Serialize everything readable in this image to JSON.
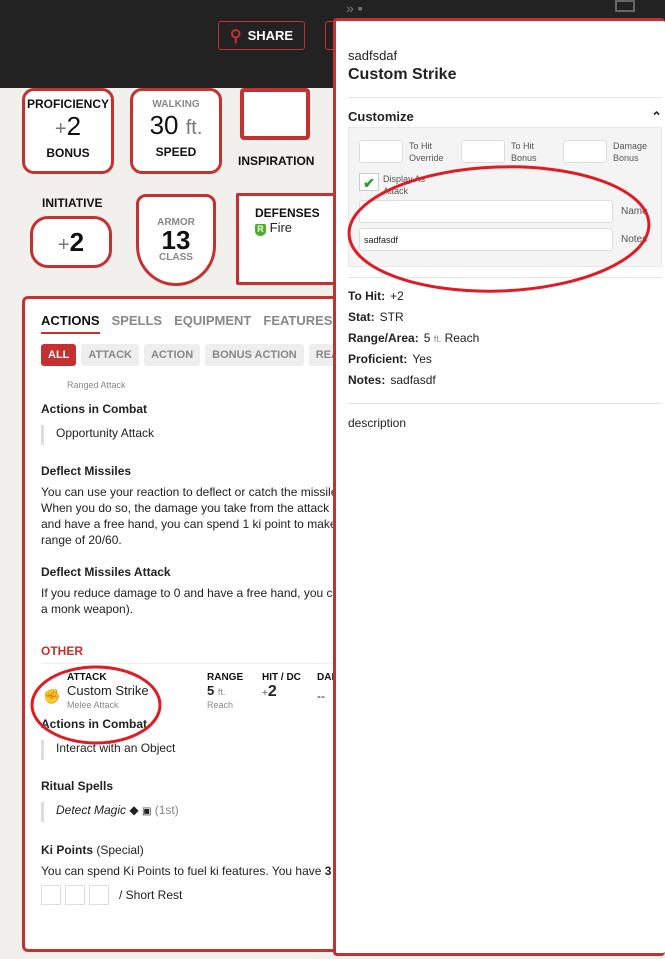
{
  "header": {
    "share_label": "SHARE"
  },
  "stats": {
    "proficiency": {
      "top": "PROFICIENCY",
      "sign": "+",
      "value": "2",
      "bottom": "BONUS"
    },
    "speed": {
      "top": "WALKING",
      "value": "30",
      "unit": "ft.",
      "bottom": "SPEED"
    },
    "inspiration": {
      "label": "INSPIRATION"
    },
    "initiative": {
      "label": "INITIATIVE",
      "sign": "+",
      "value": "2"
    },
    "armor": {
      "top": "ARMOR",
      "value": "13",
      "bottom": "CLASS"
    },
    "defenses": {
      "label": "DEFENSES",
      "items": [
        {
          "badge": "R",
          "text": "Fire",
          "color": "#4caf28"
        }
      ]
    }
  },
  "tabs": [
    "ACTIONS",
    "SPELLS",
    "EQUIPMENT",
    "FEATURES & TRAITS"
  ],
  "filters": [
    "ALL",
    "ATTACK",
    "ACTION",
    "BONUS ACTION",
    "REACTION"
  ],
  "actions": {
    "cut_top": "Ranged Attack",
    "combat1_title": "Actions in Combat",
    "combat1_item": "Opportunity Attack",
    "deflect_title": "Deflect Missiles",
    "deflect_text": [
      "You can use your reaction to deflect or catch the missile",
      "When you do so, the damage you take from the attack is",
      "and have a free hand, you can spend 1 ki point to make",
      "range of 20/60."
    ],
    "dma_title": "Deflect Missiles Attack",
    "dma_text": [
      "If you reduce damage to 0 and have a free hand, you ca",
      "a monk weapon)."
    ],
    "other_title": "OTHER",
    "attack_headers": [
      "ATTACK",
      "RANGE",
      "HIT / DC",
      "DAMAGE"
    ],
    "attack": {
      "name": "Custom Strike",
      "type": "Melee Attack",
      "range": "5",
      "range_unit": "ft.",
      "range_sub": "Reach",
      "hit_sign": "+",
      "hit": "2",
      "damage": "--"
    },
    "combat2_title": "Actions in Combat",
    "combat2_item": "Interact with an Object",
    "ritual_title": "Ritual Spells",
    "ritual_spell": "Detect Magic",
    "ritual_level": "(1st)",
    "ki_title": "Ki Points",
    "ki_sub": "(Special)",
    "ki_text": "You can spend Ki Points to fuel ki features. You have",
    "ki_count": "3",
    "ki_rest": "/ Short Rest"
  },
  "panel": {
    "subtitle": "sadfsdaf",
    "title": "Custom Strike",
    "customize_label": "Customize",
    "fields": {
      "to_hit_override": "To Hit Override",
      "to_hit_bonus": "To Hit Bonus",
      "damage_bonus": "Damage Bonus",
      "display_as_attack": "Display As Attack",
      "display_checked": true,
      "name_label": "Name",
      "name_value": "",
      "notes_label": "Notes",
      "notes_value": "sadfasdf"
    },
    "props": [
      {
        "label": "To Hit:",
        "value": "+2"
      },
      {
        "label": "Stat:",
        "value": "STR"
      },
      {
        "label": "Range/Area:",
        "value": "5",
        "unit": "ft.",
        "extra": "Reach"
      },
      {
        "label": "Proficient:",
        "value": "Yes"
      },
      {
        "label": "Notes:",
        "value": "sadfasdf"
      }
    ],
    "description": "description"
  },
  "colors": {
    "accent": "#c53131",
    "annotation": "#e01b24"
  }
}
